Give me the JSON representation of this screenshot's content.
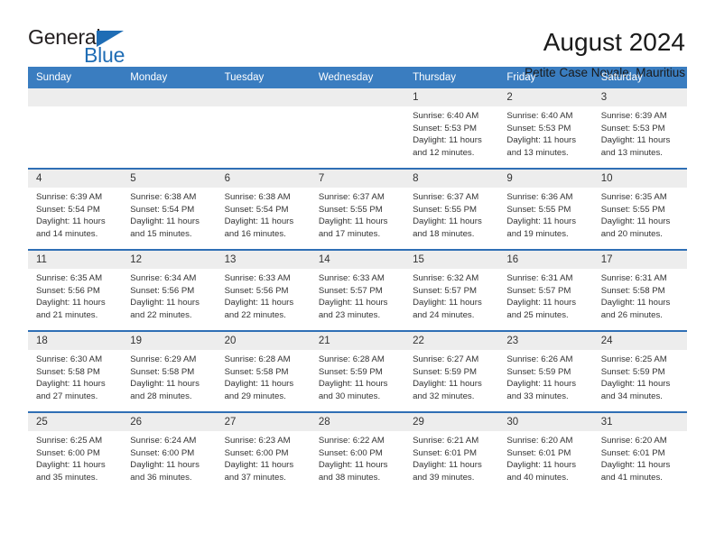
{
  "brand": {
    "name_top": "General",
    "name_bottom": "Blue",
    "accent_color": "#1f6db5"
  },
  "header": {
    "title": "August 2024",
    "subtitle": "Petite Case Noyale, Mauritius"
  },
  "calendar": {
    "header_bg": "#3a7dc0",
    "row_divider_color": "#2f6fb5",
    "day_number_bg": "#ededed",
    "weekdays": [
      "Sunday",
      "Monday",
      "Tuesday",
      "Wednesday",
      "Thursday",
      "Friday",
      "Saturday"
    ],
    "weeks": [
      [
        {
          "date": "",
          "empty": true,
          "lines": []
        },
        {
          "date": "",
          "empty": true,
          "lines": []
        },
        {
          "date": "",
          "empty": true,
          "lines": []
        },
        {
          "date": "",
          "empty": true,
          "lines": []
        },
        {
          "date": "1",
          "empty": false,
          "lines": [
            "Sunrise: 6:40 AM",
            "Sunset: 5:53 PM",
            "Daylight: 11 hours and 12 minutes."
          ]
        },
        {
          "date": "2",
          "empty": false,
          "lines": [
            "Sunrise: 6:40 AM",
            "Sunset: 5:53 PM",
            "Daylight: 11 hours and 13 minutes."
          ]
        },
        {
          "date": "3",
          "empty": false,
          "lines": [
            "Sunrise: 6:39 AM",
            "Sunset: 5:53 PM",
            "Daylight: 11 hours and 13 minutes."
          ]
        }
      ],
      [
        {
          "date": "4",
          "empty": false,
          "lines": [
            "Sunrise: 6:39 AM",
            "Sunset: 5:54 PM",
            "Daylight: 11 hours and 14 minutes."
          ]
        },
        {
          "date": "5",
          "empty": false,
          "lines": [
            "Sunrise: 6:38 AM",
            "Sunset: 5:54 PM",
            "Daylight: 11 hours and 15 minutes."
          ]
        },
        {
          "date": "6",
          "empty": false,
          "lines": [
            "Sunrise: 6:38 AM",
            "Sunset: 5:54 PM",
            "Daylight: 11 hours and 16 minutes."
          ]
        },
        {
          "date": "7",
          "empty": false,
          "lines": [
            "Sunrise: 6:37 AM",
            "Sunset: 5:55 PM",
            "Daylight: 11 hours and 17 minutes."
          ]
        },
        {
          "date": "8",
          "empty": false,
          "lines": [
            "Sunrise: 6:37 AM",
            "Sunset: 5:55 PM",
            "Daylight: 11 hours and 18 minutes."
          ]
        },
        {
          "date": "9",
          "empty": false,
          "lines": [
            "Sunrise: 6:36 AM",
            "Sunset: 5:55 PM",
            "Daylight: 11 hours and 19 minutes."
          ]
        },
        {
          "date": "10",
          "empty": false,
          "lines": [
            "Sunrise: 6:35 AM",
            "Sunset: 5:55 PM",
            "Daylight: 11 hours and 20 minutes."
          ]
        }
      ],
      [
        {
          "date": "11",
          "empty": false,
          "lines": [
            "Sunrise: 6:35 AM",
            "Sunset: 5:56 PM",
            "Daylight: 11 hours and 21 minutes."
          ]
        },
        {
          "date": "12",
          "empty": false,
          "lines": [
            "Sunrise: 6:34 AM",
            "Sunset: 5:56 PM",
            "Daylight: 11 hours and 22 minutes."
          ]
        },
        {
          "date": "13",
          "empty": false,
          "lines": [
            "Sunrise: 6:33 AM",
            "Sunset: 5:56 PM",
            "Daylight: 11 hours and 22 minutes."
          ]
        },
        {
          "date": "14",
          "empty": false,
          "lines": [
            "Sunrise: 6:33 AM",
            "Sunset: 5:57 PM",
            "Daylight: 11 hours and 23 minutes."
          ]
        },
        {
          "date": "15",
          "empty": false,
          "lines": [
            "Sunrise: 6:32 AM",
            "Sunset: 5:57 PM",
            "Daylight: 11 hours and 24 minutes."
          ]
        },
        {
          "date": "16",
          "empty": false,
          "lines": [
            "Sunrise: 6:31 AM",
            "Sunset: 5:57 PM",
            "Daylight: 11 hours and 25 minutes."
          ]
        },
        {
          "date": "17",
          "empty": false,
          "lines": [
            "Sunrise: 6:31 AM",
            "Sunset: 5:58 PM",
            "Daylight: 11 hours and 26 minutes."
          ]
        }
      ],
      [
        {
          "date": "18",
          "empty": false,
          "lines": [
            "Sunrise: 6:30 AM",
            "Sunset: 5:58 PM",
            "Daylight: 11 hours and 27 minutes."
          ]
        },
        {
          "date": "19",
          "empty": false,
          "lines": [
            "Sunrise: 6:29 AM",
            "Sunset: 5:58 PM",
            "Daylight: 11 hours and 28 minutes."
          ]
        },
        {
          "date": "20",
          "empty": false,
          "lines": [
            "Sunrise: 6:28 AM",
            "Sunset: 5:58 PM",
            "Daylight: 11 hours and 29 minutes."
          ]
        },
        {
          "date": "21",
          "empty": false,
          "lines": [
            "Sunrise: 6:28 AM",
            "Sunset: 5:59 PM",
            "Daylight: 11 hours and 30 minutes."
          ]
        },
        {
          "date": "22",
          "empty": false,
          "lines": [
            "Sunrise: 6:27 AM",
            "Sunset: 5:59 PM",
            "Daylight: 11 hours and 32 minutes."
          ]
        },
        {
          "date": "23",
          "empty": false,
          "lines": [
            "Sunrise: 6:26 AM",
            "Sunset: 5:59 PM",
            "Daylight: 11 hours and 33 minutes."
          ]
        },
        {
          "date": "24",
          "empty": false,
          "lines": [
            "Sunrise: 6:25 AM",
            "Sunset: 5:59 PM",
            "Daylight: 11 hours and 34 minutes."
          ]
        }
      ],
      [
        {
          "date": "25",
          "empty": false,
          "lines": [
            "Sunrise: 6:25 AM",
            "Sunset: 6:00 PM",
            "Daylight: 11 hours and 35 minutes."
          ]
        },
        {
          "date": "26",
          "empty": false,
          "lines": [
            "Sunrise: 6:24 AM",
            "Sunset: 6:00 PM",
            "Daylight: 11 hours and 36 minutes."
          ]
        },
        {
          "date": "27",
          "empty": false,
          "lines": [
            "Sunrise: 6:23 AM",
            "Sunset: 6:00 PM",
            "Daylight: 11 hours and 37 minutes."
          ]
        },
        {
          "date": "28",
          "empty": false,
          "lines": [
            "Sunrise: 6:22 AM",
            "Sunset: 6:00 PM",
            "Daylight: 11 hours and 38 minutes."
          ]
        },
        {
          "date": "29",
          "empty": false,
          "lines": [
            "Sunrise: 6:21 AM",
            "Sunset: 6:01 PM",
            "Daylight: 11 hours and 39 minutes."
          ]
        },
        {
          "date": "30",
          "empty": false,
          "lines": [
            "Sunrise: 6:20 AM",
            "Sunset: 6:01 PM",
            "Daylight: 11 hours and 40 minutes."
          ]
        },
        {
          "date": "31",
          "empty": false,
          "lines": [
            "Sunrise: 6:20 AM",
            "Sunset: 6:01 PM",
            "Daylight: 11 hours and 41 minutes."
          ]
        }
      ]
    ]
  }
}
